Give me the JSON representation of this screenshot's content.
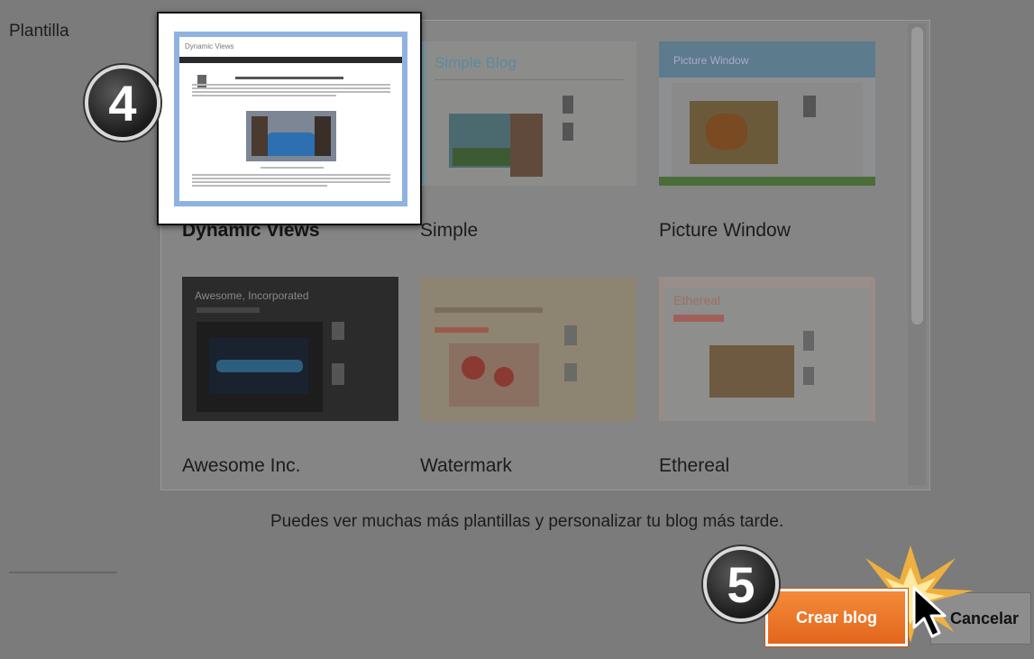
{
  "form": {
    "template_label": "Plantilla",
    "hint": "Puedes ver muchas más plantillas y personalizar tu blog más tarde."
  },
  "templates": [
    {
      "name": "Dynamic Views",
      "selected": true
    },
    {
      "name": "Simple",
      "selected": false
    },
    {
      "name": "Picture Window",
      "selected": false
    },
    {
      "name": "Awesome Inc.",
      "selected": false
    },
    {
      "name": "Watermark",
      "selected": false
    },
    {
      "name": "Ethereal",
      "selected": false
    }
  ],
  "previews": {
    "dynamic_views_title": "Dynamic Views",
    "simple_title": "Simple Blog",
    "picture_window_title": "Picture Window",
    "awesome_title": "Awesome, Incorporated",
    "ethereal_title": "Ethereal"
  },
  "badges": {
    "step_four": "4",
    "step_five": "5"
  },
  "buttons": {
    "create": "Crear blog",
    "cancel": "Cancelar"
  },
  "colors": {
    "accent": "#f07a2a",
    "selection_border": "#8fb2e2"
  }
}
